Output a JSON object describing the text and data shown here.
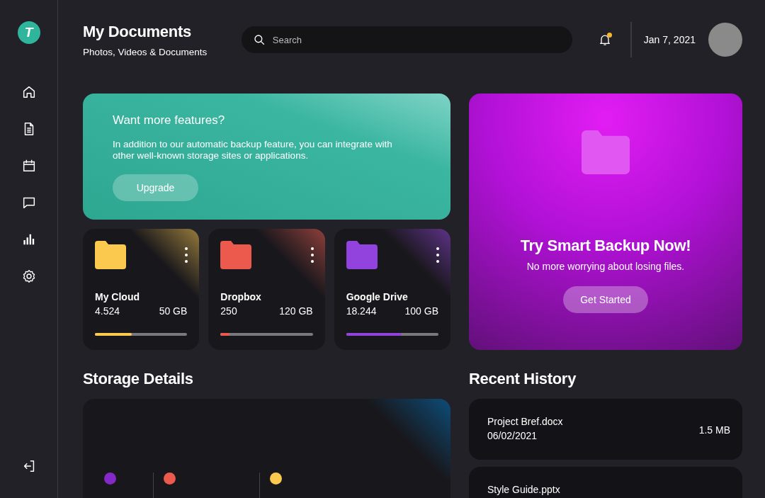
{
  "logo": {
    "letter": "T"
  },
  "header": {
    "title": "My Documents",
    "subtitle": "Photos, Videos & Documents",
    "search": {
      "placeholder": "Search"
    },
    "notifications": {
      "unread": true
    },
    "date": "Jan 7, 2021"
  },
  "promo": {
    "title": "Want more features?",
    "text": "In addition to our automatic backup feature, you can integrate with other well-known storage sites or applications.",
    "button": "Upgrade"
  },
  "storages": [
    {
      "name": "My Cloud",
      "count": "4.524",
      "size": "50 GB",
      "level": 0.4,
      "color": "#fcc94f"
    },
    {
      "name": "Dropbox",
      "count": "250",
      "size": "120 GB",
      "level": 0.1,
      "color": "#ec5a4e"
    },
    {
      "name": "Google Drive",
      "count": "18.244",
      "size": "100 GB",
      "level": 0.6,
      "color": "#9242dd"
    }
  ],
  "backup": {
    "title": "Try Smart Backup Now!",
    "text": "No more worrying about losing files.",
    "button": "Get Started"
  },
  "storage_details": {
    "title": "Storage Details",
    "legend": [
      {
        "color": "#8429c6"
      },
      {
        "color": "#ec5a4e"
      },
      {
        "color": "#fcc94f"
      }
    ]
  },
  "recent_history": {
    "title": "Recent History",
    "items": [
      {
        "name": "Project Bref.docx",
        "date": "06/02/2021",
        "size": "1.5 MB"
      },
      {
        "name": "Style Guide.pptx"
      }
    ]
  }
}
